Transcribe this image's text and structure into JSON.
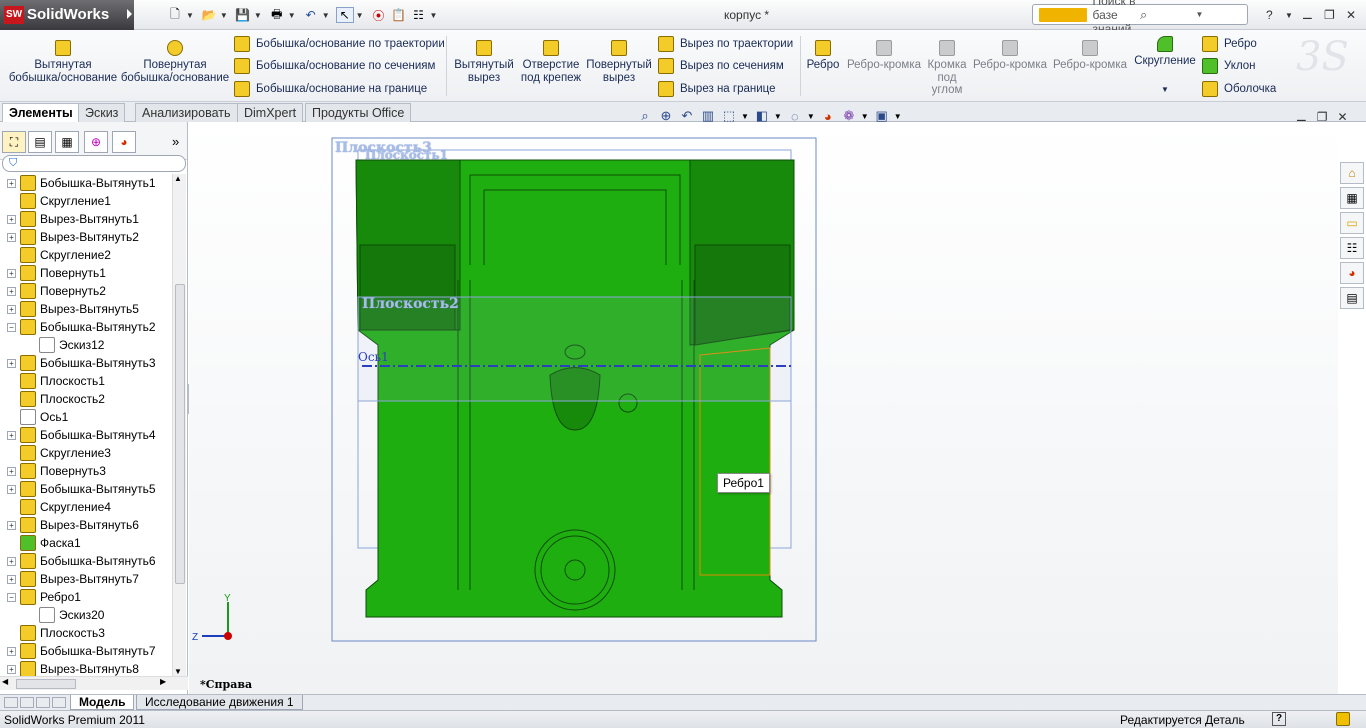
{
  "app": {
    "logo": "SolidWorks",
    "badge": "SW",
    "document_title": "корпус *"
  },
  "search": {
    "placeholder": "Поиск в базе знаний"
  },
  "window_controls": {
    "help": "?",
    "minimize": "⚊",
    "restore": "❐",
    "close": "✕"
  },
  "ribbon": {
    "extruded_boss": "Вытянутая бобышка/основание",
    "revolved_boss": "Повернутая бобышка/основание",
    "swept_boss": "Бобышка/основание по траектории",
    "lofted_boss": "Бобышка/основание по сечениям",
    "boundary_boss": "Бобышка/основание на границе",
    "extruded_cut": "Вытянутый вырез",
    "hole_wizard": "Отверстие под крепеж",
    "revolved_cut": "Повернутый вырез",
    "swept_cut": "Вырез по траектории",
    "lofted_cut": "Вырез по сечениям",
    "boundary_cut": "Вырез на границе",
    "rib_small": "Ребро",
    "edge_flange1": "Ребро-кромка",
    "miter_flange": "Кромка под углом",
    "edge_flange2": "Ребро-кромка",
    "edge_flange3": "Ребро-кромка",
    "fillet": "Скругление",
    "rib": "Ребро",
    "draft": "Уклон",
    "shell": "Оболочка"
  },
  "tabs": [
    "Элементы",
    "Эскиз",
    "Анализировать",
    "DimXpert",
    "Продукты Office"
  ],
  "tree": [
    {
      "label": "Бобышка-Вытянуть1",
      "icon": "extrude-boss-icon",
      "expand": "+"
    },
    {
      "label": "Скругление1",
      "icon": "fillet-icon",
      "expand": ""
    },
    {
      "label": "Вырез-Вытянуть1",
      "icon": "extrude-cut-icon",
      "expand": "+"
    },
    {
      "label": "Вырез-Вытянуть2",
      "icon": "extrude-cut-icon",
      "expand": "+"
    },
    {
      "label": "Скругление2",
      "icon": "fillet-icon",
      "expand": ""
    },
    {
      "label": "Повернуть1",
      "icon": "revolve-icon",
      "expand": "+"
    },
    {
      "label": "Повернуть2",
      "icon": "revolve-icon",
      "expand": "+"
    },
    {
      "label": "Вырез-Вытянуть5",
      "icon": "extrude-cut-icon",
      "expand": "+"
    },
    {
      "label": "Бобышка-Вытянуть2",
      "icon": "extrude-boss-icon",
      "expand": "−"
    },
    {
      "label": "Эскиз12",
      "icon": "sketch-icon",
      "expand": "",
      "indent": true
    },
    {
      "label": "Бобышка-Вытянуть3",
      "icon": "extrude-boss-icon",
      "expand": "+"
    },
    {
      "label": "Плоскость1",
      "icon": "plane-icon",
      "expand": ""
    },
    {
      "label": "Плоскость2",
      "icon": "plane-icon",
      "expand": ""
    },
    {
      "label": "Ось1",
      "icon": "axis-icon",
      "expand": ""
    },
    {
      "label": "Бобышка-Вытянуть4",
      "icon": "extrude-boss-icon",
      "expand": "+"
    },
    {
      "label": "Скругление3",
      "icon": "fillet-icon",
      "expand": ""
    },
    {
      "label": "Повернуть3",
      "icon": "revolve-icon",
      "expand": "+"
    },
    {
      "label": "Бобышка-Вытянуть5",
      "icon": "extrude-boss-icon",
      "expand": "+"
    },
    {
      "label": "Скругление4",
      "icon": "fillet-icon",
      "expand": ""
    },
    {
      "label": "Вырез-Вытянуть6",
      "icon": "extrude-cut-icon",
      "expand": "+"
    },
    {
      "label": "Фаска1",
      "icon": "chamfer-icon",
      "expand": ""
    },
    {
      "label": "Бобышка-Вытянуть6",
      "icon": "extrude-boss-icon",
      "expand": "+"
    },
    {
      "label": "Вырез-Вытянуть7",
      "icon": "extrude-cut-icon",
      "expand": "+"
    },
    {
      "label": "Ребро1",
      "icon": "rib-icon",
      "expand": "−"
    },
    {
      "label": "Эскиз20",
      "icon": "sketch-icon",
      "expand": "",
      "indent": true
    },
    {
      "label": "Плоскость3",
      "icon": "plane-icon",
      "expand": ""
    },
    {
      "label": "Бобышка-Вытянуть7",
      "icon": "extrude-boss-icon",
      "expand": "+"
    },
    {
      "label": "Вырез-Вытянуть8",
      "icon": "extrude-cut-icon",
      "expand": "+"
    }
  ],
  "viewport": {
    "plane3": "Плоскость3",
    "plane1": "Плоскость1",
    "plane2": "Плоскость2",
    "axis1": "Ось1",
    "tooltip": "Ребро1",
    "view_name": "*Справа",
    "triad": {
      "y": "Y",
      "z": "Z"
    }
  },
  "bottom_tabs": {
    "model": "Модель",
    "motion": "Исследование движения 1"
  },
  "status": {
    "left": "SolidWorks Premium 2011",
    "right": "Редактируется Деталь",
    "help": "?"
  },
  "colors": {
    "model_green": "#1fae10",
    "model_dark": "#178a0c",
    "plane_blue": "#6d89c8",
    "axis_blue": "#2b3fc0"
  }
}
